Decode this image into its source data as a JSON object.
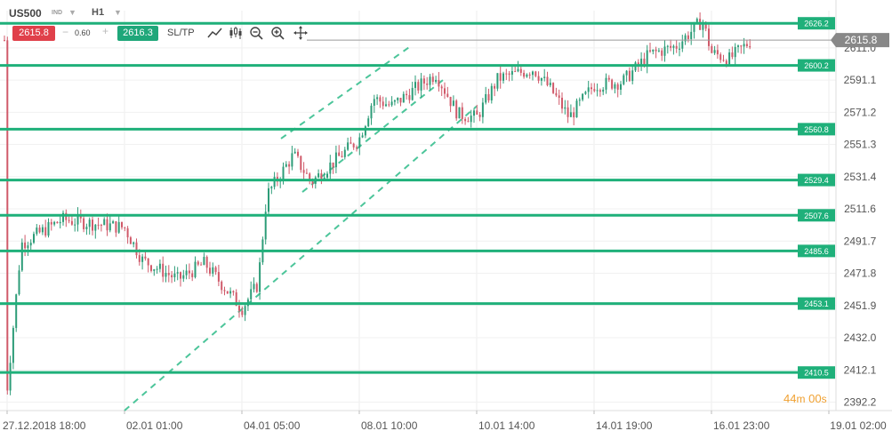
{
  "header": {
    "symbol": "US500",
    "symbol_type": "IND",
    "timeframe": "H1",
    "sell_price": "2615.8",
    "spread": "0.60",
    "buy_price": "2616.3",
    "sltp_label": "SL/TP",
    "tools": [
      "line-chart-icon",
      "candlestick-icon",
      "zoom-out-icon",
      "zoom-in-icon",
      "crosshair-icon"
    ]
  },
  "timer": {
    "minutes": "44",
    "min_unit": "m",
    "seconds": "00",
    "sec_unit": "s"
  },
  "colors": {
    "up": "#2d9c78",
    "down": "#d05a6a",
    "level_line": "#1fb07a",
    "channel": "#4cc59a",
    "price_tag": "#888888",
    "axis_text": "#555555"
  },
  "chart_data": {
    "type": "candlestick",
    "symbol": "US500",
    "timeframe": "H1",
    "current_price": 2615.8,
    "ylim": [
      2387,
      2634
    ],
    "y_ticks": [
      2611.0,
      2591.1,
      2571.2,
      2551.3,
      2531.4,
      2511.6,
      2491.7,
      2471.8,
      2451.9,
      2432.0,
      2412.1,
      2392.2
    ],
    "x_ticks": [
      "27.12.2018 18:00",
      "02.01 01:00",
      "04.01 05:00",
      "08.01 10:00",
      "10.01 14:00",
      "14.01 19:00",
      "16.01 23:00",
      "19.01 02:00"
    ],
    "horizontal_levels": [
      2626.2,
      2600.2,
      2560.8,
      2529.4,
      2507.6,
      2485.6,
      2453.1,
      2410.5
    ],
    "channel": {
      "lower": [
        [
          "02.01 01:00",
          2387
        ],
        [
          "10.01 14:00",
          2575
        ]
      ],
      "upper": [
        [
          "04.01 05:00",
          2555
        ],
        [
          "08.01 10:00",
          2602
        ]
      ]
    },
    "path": [
      [
        "27.12.2018 18:00",
        2400
      ],
      [
        "28.12",
        2490
      ],
      [
        "31.12",
        2505
      ],
      [
        "02.01 01:00",
        2500
      ],
      [
        "02.01 12:00",
        2480
      ],
      [
        "03.01",
        2468
      ],
      [
        "03.01 12:00",
        2478
      ],
      [
        "04.01 05:00",
        2450
      ],
      [
        "04.01 12:00",
        2465
      ],
      [
        "04.01 20:00",
        2520
      ],
      [
        "07.01",
        2545
      ],
      [
        "07.01 20:00",
        2528
      ],
      [
        "08.01 10:00",
        2555
      ],
      [
        "08.01 20:00",
        2580
      ],
      [
        "09.01",
        2575
      ],
      [
        "09.01 20:00",
        2595
      ],
      [
        "10.01",
        2570
      ],
      [
        "10.01 14:00",
        2568
      ],
      [
        "10.01 20:00",
        2592
      ],
      [
        "11.01",
        2598
      ],
      [
        "11.01 20:00",
        2585
      ],
      [
        "14.01",
        2568
      ],
      [
        "14.01 19:00",
        2588
      ],
      [
        "15.01",
        2590
      ],
      [
        "15.01 12:00",
        2607
      ],
      [
        "16.01",
        2612
      ],
      [
        "16.01 12:00",
        2628
      ],
      [
        "16.01 23:00",
        2608
      ],
      [
        "17.01",
        2604
      ],
      [
        "17.01 12:00",
        2615.8
      ]
    ]
  }
}
